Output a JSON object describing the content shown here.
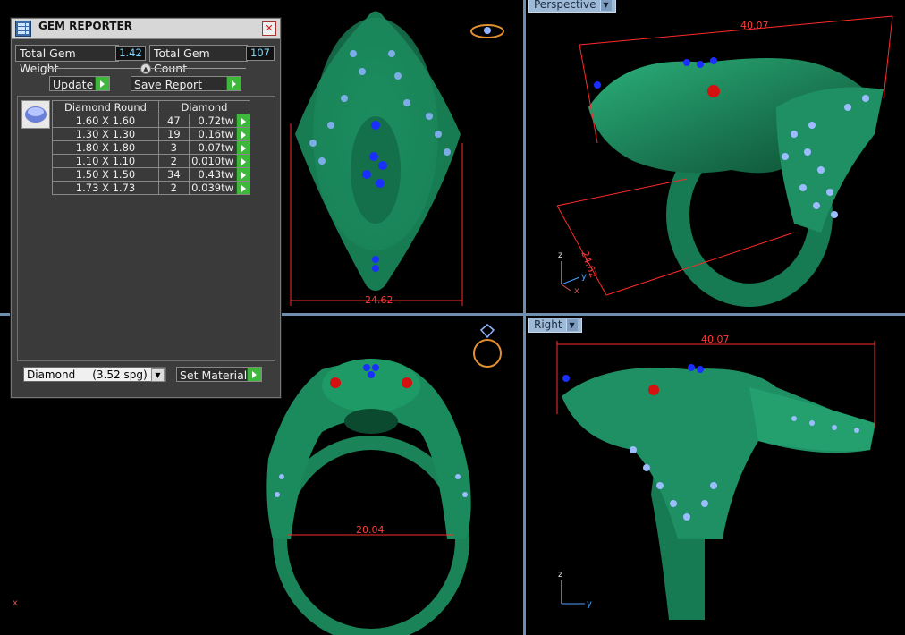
{
  "panel": {
    "title": "GEM REPORTER",
    "total_weight_label": "Total Gem Weight",
    "total_weight_value": "1.42",
    "total_count_label": "Total Gem Count",
    "total_count_value": "107",
    "update_label": "Update",
    "save_report_label": "Save Report",
    "table_headers": [
      "Diamond Round",
      "Diamond"
    ],
    "rows": [
      {
        "size": "1.60 X 1.60",
        "count": "47",
        "weight": "0.72tw"
      },
      {
        "size": "1.30 X 1.30",
        "count": "19",
        "weight": "0.16tw"
      },
      {
        "size": "1.80 X 1.80",
        "count": "3",
        "weight": "0.07tw"
      },
      {
        "size": "1.10 X 1.10",
        "count": "2",
        "weight": "0.010tw"
      },
      {
        "size": "1.50 X 1.50",
        "count": "34",
        "weight": "0.43tw"
      },
      {
        "size": "1.73 X 1.73",
        "count": "2",
        "weight": "0.039tw"
      }
    ],
    "material_select": "Diamond     (3.52 spg)",
    "set_material_label": "Set Material"
  },
  "viewports": {
    "perspective_tab": "Perspective",
    "right_tab": "Right"
  },
  "dimensions": {
    "top_width": "24.62",
    "persp_length": "40.07",
    "persp_height": "24.62",
    "front_inner": "20.04",
    "right_length": "40.07"
  },
  "axes": {
    "z": "z",
    "y": "y",
    "x": "x"
  },
  "colors": {
    "model": "#1e8a5e",
    "gem": "#8fb4ff",
    "dim": "#ff2a2a",
    "viewport_border": "#6f8fb0"
  }
}
